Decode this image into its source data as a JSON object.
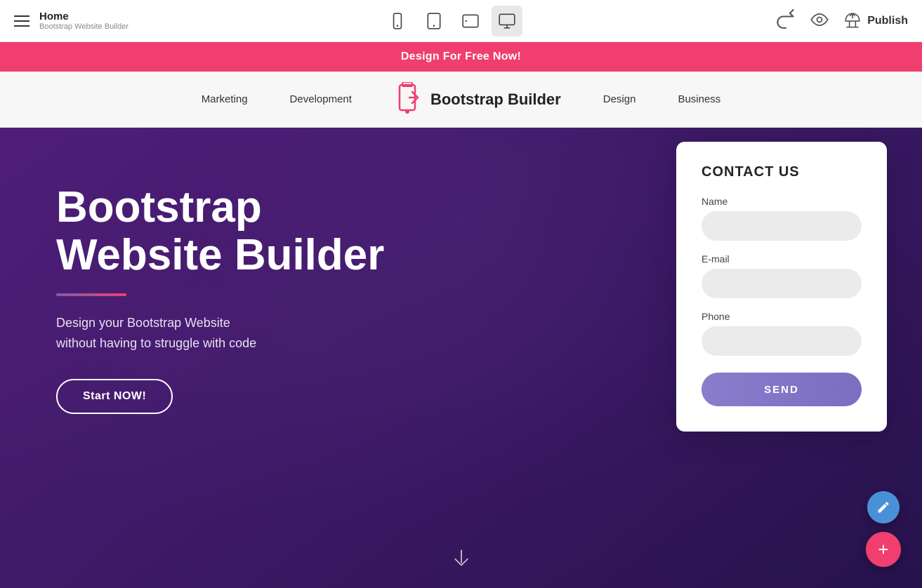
{
  "topbar": {
    "title": "Home",
    "subtitle": "Bootstrap Website Builder",
    "devices": [
      {
        "id": "mobile",
        "label": "Mobile view"
      },
      {
        "id": "tablet",
        "label": "Tablet view"
      },
      {
        "id": "tablet-landscape",
        "label": "Tablet landscape view"
      },
      {
        "id": "desktop",
        "label": "Desktop view",
        "active": true
      }
    ],
    "publish_label": "Publish"
  },
  "promo_banner": {
    "text": "Design For Free Now!"
  },
  "site_nav": {
    "items": [
      {
        "label": "Marketing"
      },
      {
        "label": "Development"
      },
      {
        "label": "Design"
      },
      {
        "label": "Business"
      }
    ],
    "brand_name": "Bootstrap Builder"
  },
  "hero": {
    "title_line1": "Bootstrap",
    "title_line2": "Website Builder",
    "subtitle": "Design your Bootstrap Website\nwithout having to struggle with code",
    "cta_label": "Start NOW!"
  },
  "contact_form": {
    "title": "CONTACT US",
    "name_label": "Name",
    "name_placeholder": "",
    "email_label": "E-mail",
    "email_placeholder": "",
    "phone_label": "Phone",
    "phone_placeholder": "",
    "send_label": "SEND"
  },
  "colors": {
    "promo_pink": "#f03e6e",
    "send_purple": "#8a7dcc",
    "fab_blue": "#4a90d9",
    "fab_red": "#f03e6e"
  }
}
